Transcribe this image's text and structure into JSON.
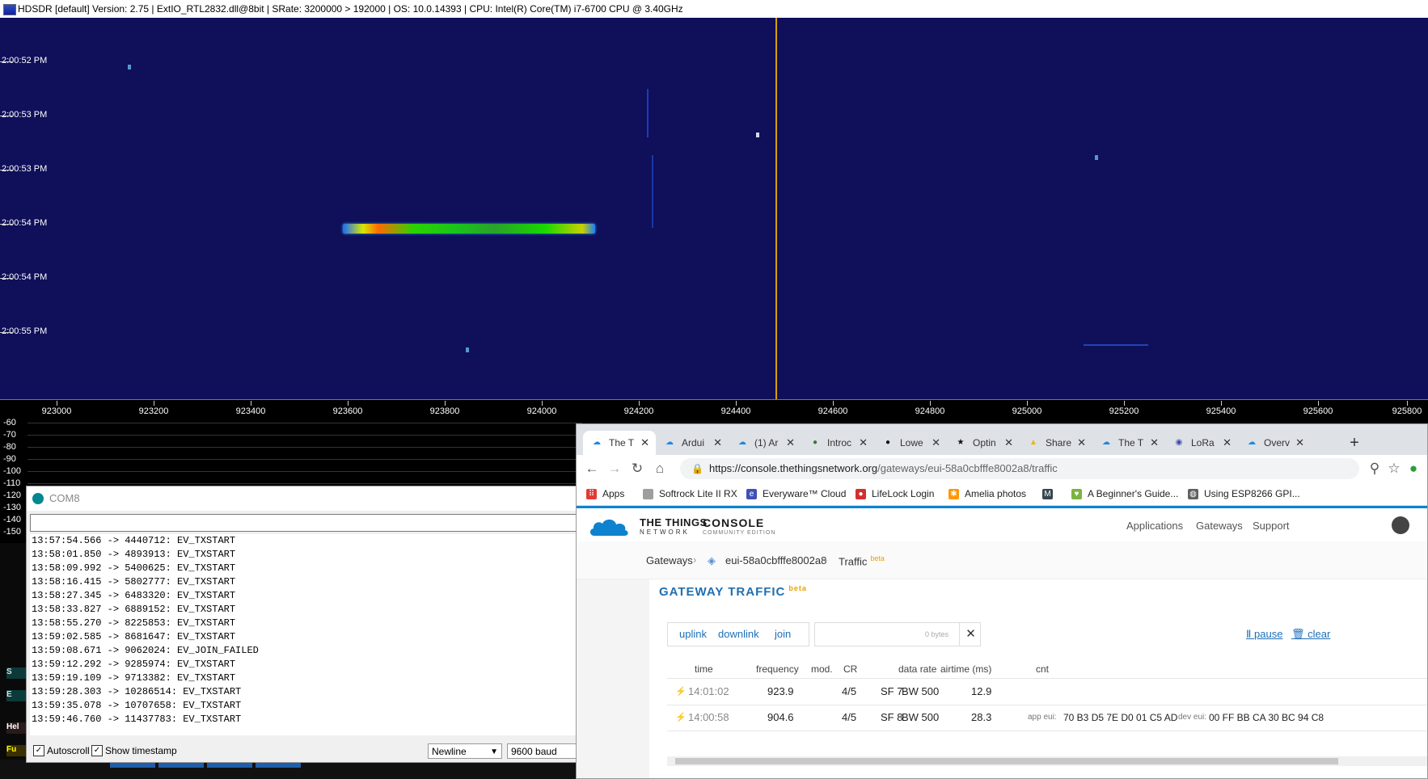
{
  "hdsdr": {
    "title": "HDSDR  [default]  Version: 2.75   |  ExtIO_RTL2832.dll@8bit  |  SRate: 3200000 > 192000  |  OS: 10.0.14393   |  CPU: Intel(R) Core(TM) i7-6700 CPU @ 3.40GHz",
    "time_labels": [
      "2:00:52 PM",
      "2:00:53 PM",
      "2:00:53 PM",
      "2:00:54 PM",
      "2:00:54 PM",
      "2:00:55 PM"
    ],
    "freq_labels": [
      "923000",
      "923200",
      "923400",
      "923600",
      "923800",
      "924000",
      "924200",
      "924400",
      "924600",
      "924800",
      "925000",
      "925200",
      "925400",
      "925600",
      "925800"
    ],
    "db_labels": [
      "-60",
      "-70",
      "-80",
      "-90",
      "-100",
      "-110",
      "-120",
      "-130",
      "-140",
      "-150"
    ],
    "left_buttons": [
      "S",
      "E",
      "Hel",
      "Fu"
    ],
    "colors": {
      "waterfall_bg": "#0f0f5a",
      "center_line": "#d8a000"
    }
  },
  "serial": {
    "title": "COM8",
    "log": [
      "13:57:54.566 -> 4440712: EV_TXSTART",
      "13:58:01.850 -> 4893913: EV_TXSTART",
      "13:58:09.992 -> 5400625: EV_TXSTART",
      "13:58:16.415 -> 5802777: EV_TXSTART",
      "13:58:27.345 -> 6483320: EV_TXSTART",
      "13:58:33.827 -> 6889152: EV_TXSTART",
      "13:58:55.270 -> 8225853: EV_TXSTART",
      "13:59:02.585 -> 8681647: EV_TXSTART",
      "13:59:08.671 -> 9062024: EV_JOIN_FAILED",
      "13:59:12.292 -> 9285974: EV_TXSTART",
      "13:59:19.109 -> 9713382: EV_TXSTART",
      "13:59:28.303 -> 10286514: EV_TXSTART",
      "13:59:35.078 -> 10707658: EV_TXSTART",
      "13:59:46.760 -> 11437783: EV_TXSTART"
    ],
    "autoscroll_label": "Autoscroll",
    "timestamp_label": "Show timestamp",
    "line_ending": "Newline",
    "baud": "9600 baud"
  },
  "browser": {
    "tabs": [
      {
        "label": "The T",
        "icon": "ttn-cloud-icon"
      },
      {
        "label": "Ardui",
        "icon": "ttn-cloud-icon"
      },
      {
        "label": "(1) Ar",
        "icon": "ttn-cloud-icon"
      },
      {
        "label": "Introc",
        "icon": "leaf-icon"
      },
      {
        "label": "Lowe",
        "icon": "github-icon"
      },
      {
        "label": "Optin",
        "icon": "star-icon"
      },
      {
        "label": "Share",
        "icon": "drive-icon"
      },
      {
        "label": "The T",
        "icon": "ttn-cloud-icon"
      },
      {
        "label": "LoRa",
        "icon": "circle-icon"
      },
      {
        "label": "Overv",
        "icon": "ttn-cloud-icon"
      }
    ],
    "url_host": "https://console.thethingsnetwork.org",
    "url_path": "/gateways/eui-58a0cbfffe8002a8/traffic",
    "bookmarks": [
      "Apps",
      "Softrock Lite II RX",
      "Everyware™ Cloud",
      "LifeLock Login",
      "Amelia photos",
      "M",
      "A Beginner's Guide...",
      "Using ESP8266 GPI..."
    ]
  },
  "ttn": {
    "brand_line1": "THE THINGS",
    "brand_line2": "NETWORK",
    "console": "CONSOLE",
    "edition": "COMMUNITY EDITION",
    "nav": [
      "Applications",
      "Gateways",
      "Support"
    ],
    "breadcrumb": {
      "gateways": "Gateways",
      "gateway_id": "eui-58a0cbfffe8002a8",
      "traffic": "Traffic",
      "beta": "beta"
    },
    "page_title": "GATEWAY TRAFFIC",
    "title_beta": "beta",
    "filters": [
      "uplink",
      "downlink",
      "join"
    ],
    "bytes": "0 bytes",
    "pause": "pause",
    "clear": "clear",
    "headers": {
      "time": "time",
      "frequency": "frequency",
      "mod": "mod.",
      "cr": "CR",
      "datarate": "data rate",
      "airtime": "airtime (ms)",
      "cnt": "cnt"
    },
    "rows": [
      {
        "time": "14:01:02",
        "freq": "923.9",
        "cr": "4/5",
        "sf": "SF 7",
        "bw": "BW 500",
        "airtime": "12.9",
        "app_eui_label": "",
        "app_eui": "",
        "dev_eui_label": "",
        "dev_eui": ""
      },
      {
        "time": "14:00:58",
        "freq": "904.6",
        "cr": "4/5",
        "sf": "SF 8",
        "bw": "BW 500",
        "airtime": "28.3",
        "app_eui_label": "app eui:",
        "app_eui": "70 B3 D5 7E D0 01 C5 AD",
        "dev_eui_label": "dev eui:",
        "dev_eui": "00 FF BB CA 30 BC 94 C8"
      }
    ]
  }
}
